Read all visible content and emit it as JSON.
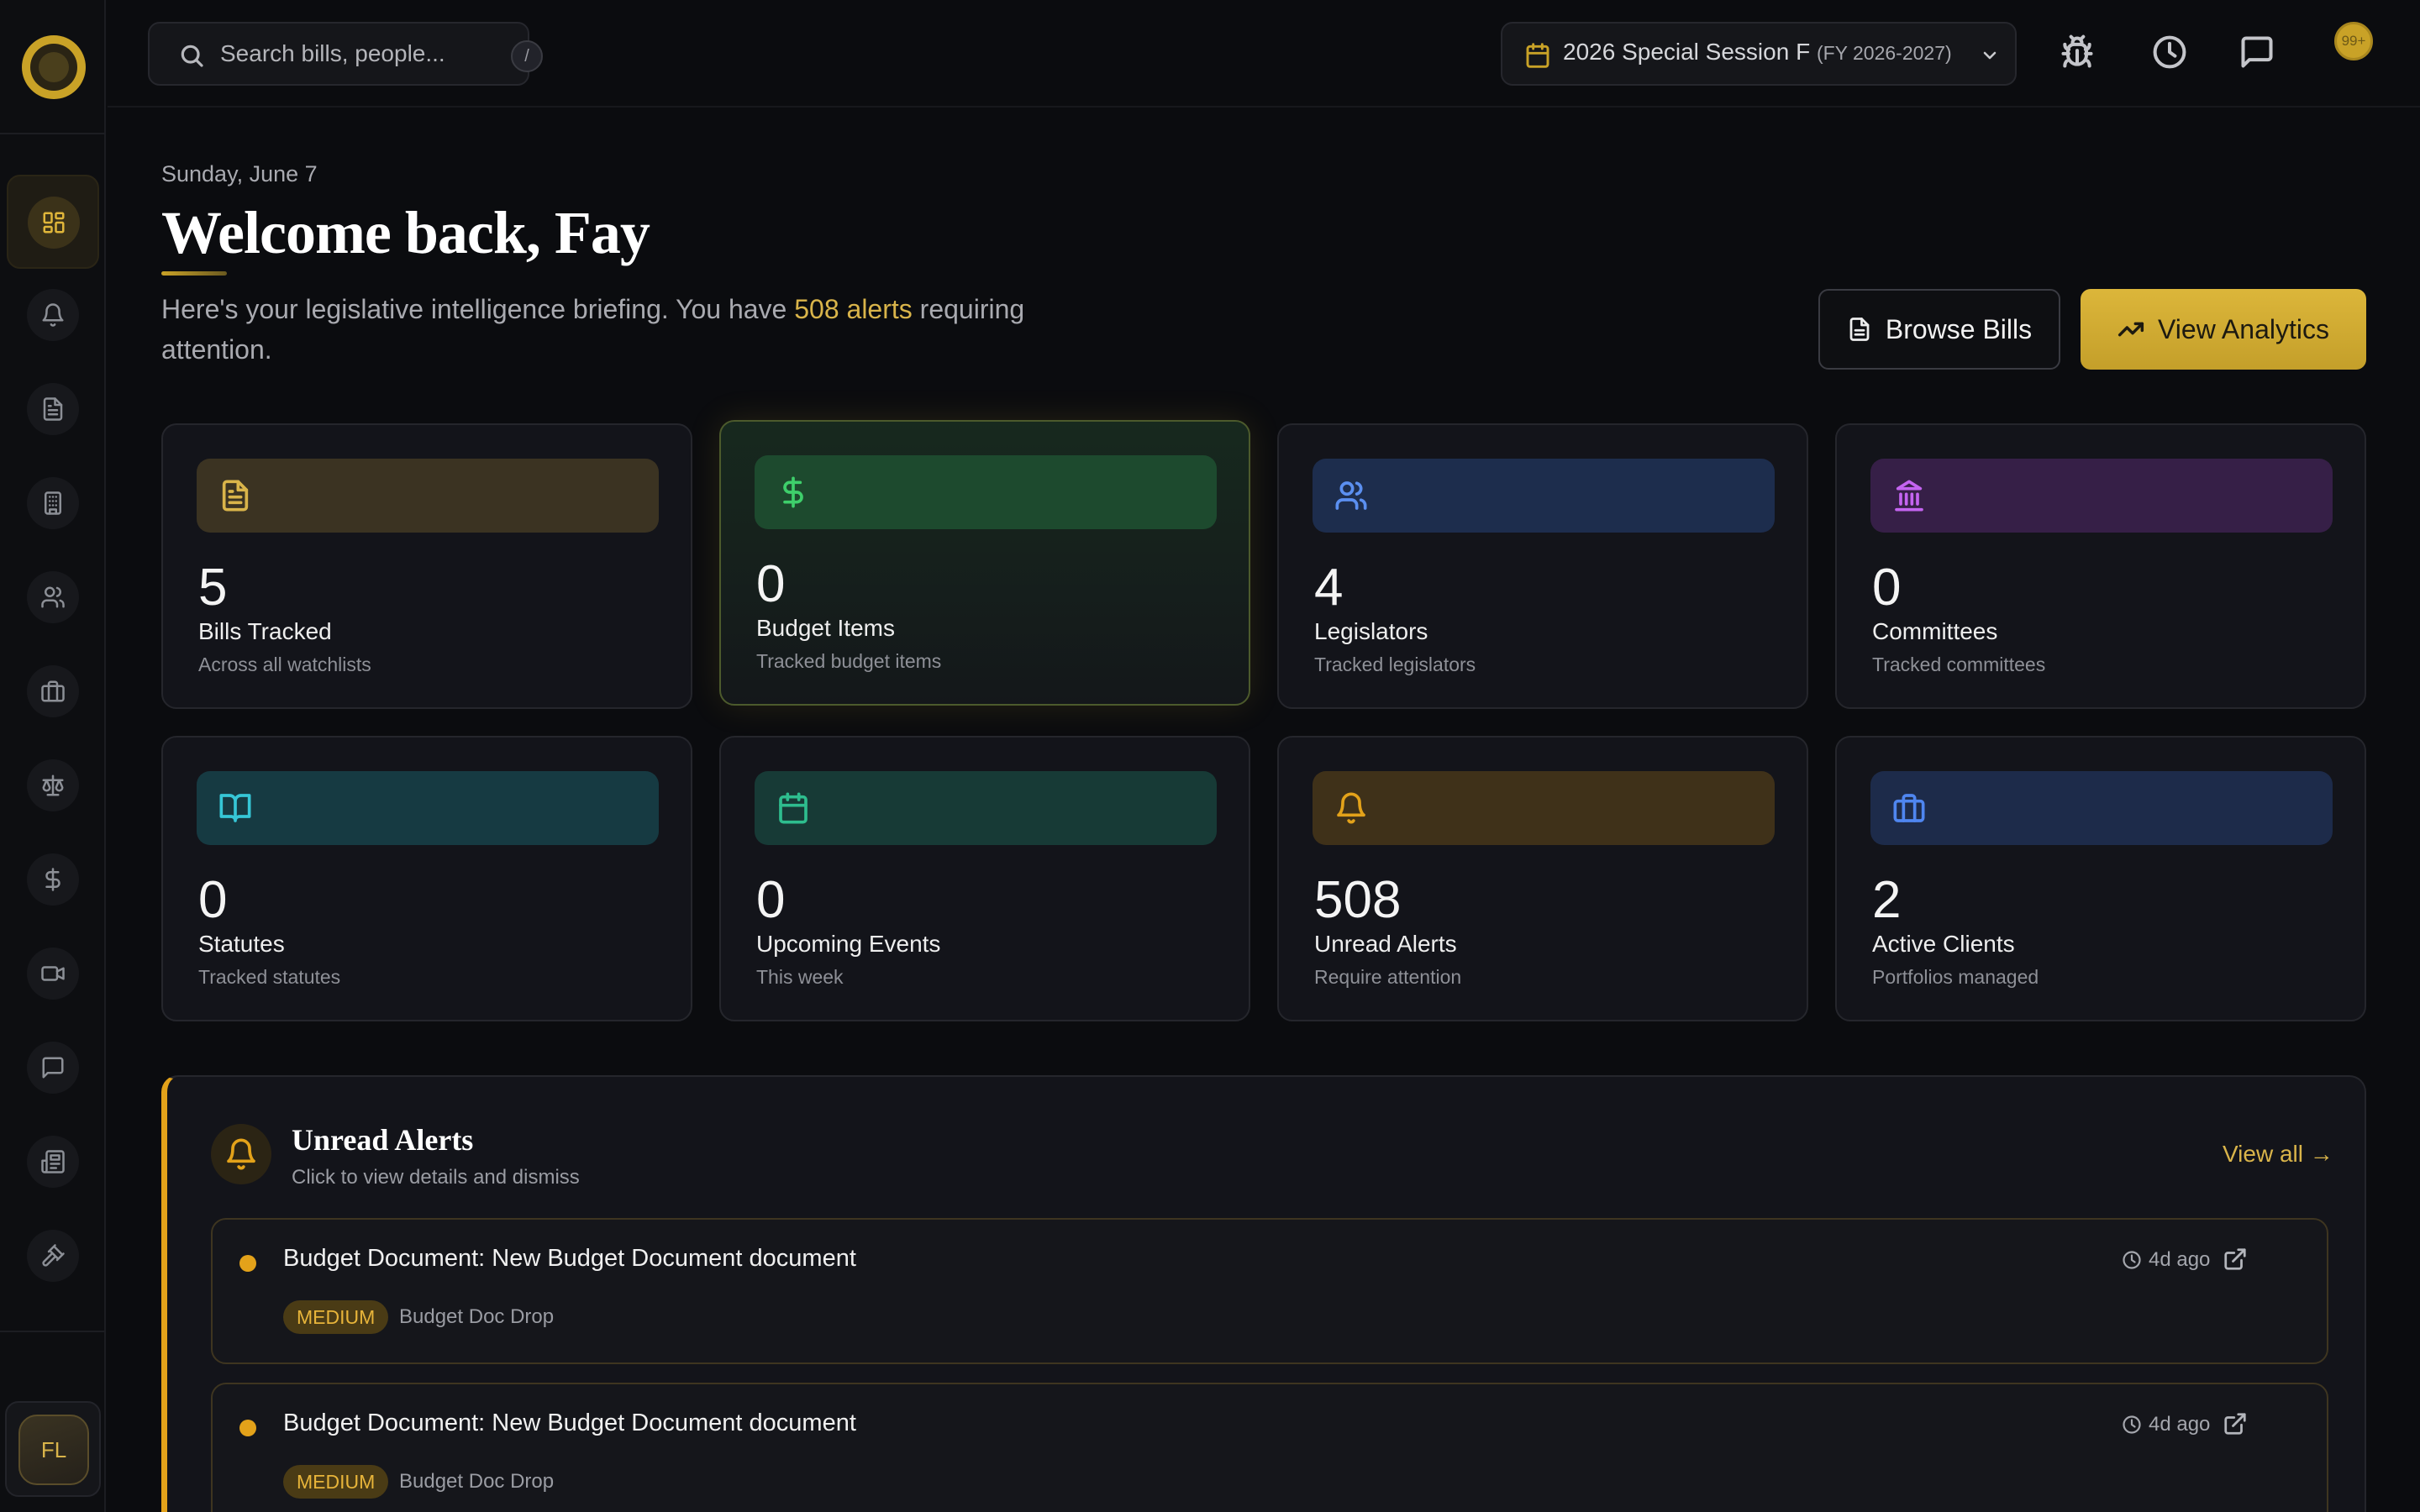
{
  "app": {
    "accent": "#c9a227",
    "background": "#0b0c0f"
  },
  "sidebar": {
    "items": [
      {
        "name": "dashboard",
        "icon": "dashboard-icon",
        "active": true
      },
      {
        "name": "alerts",
        "icon": "bell-icon"
      },
      {
        "name": "bills",
        "icon": "document-icon"
      },
      {
        "name": "buildings",
        "icon": "building-icon"
      },
      {
        "name": "people",
        "icon": "users-icon"
      },
      {
        "name": "clients",
        "icon": "briefcase-icon"
      },
      {
        "name": "statutes-law",
        "icon": "scale-icon"
      },
      {
        "name": "budget",
        "icon": "dollar-icon"
      },
      {
        "name": "video",
        "icon": "video-icon"
      },
      {
        "name": "messages",
        "icon": "chat-icon"
      },
      {
        "name": "news",
        "icon": "newspaper-icon"
      },
      {
        "name": "hearings",
        "icon": "gavel-icon"
      }
    ],
    "user_initials": "FL"
  },
  "topbar": {
    "search_placeholder": "Search bills, people...",
    "search_shortcut": "/",
    "session_label": "2026 Special Session F",
    "session_fy": "(FY 2026-2027)",
    "notification_badge": "99+",
    "icons": [
      "bug-icon",
      "history-icon",
      "chat-icon",
      "bell-icon"
    ]
  },
  "header": {
    "date": "Sunday, June 7",
    "welcome": "Welcome back, Fay",
    "intro_before": "Here's your legislative intelligence briefing. You have ",
    "intro_highlight": "508 alerts",
    "intro_after": " requiring attention.",
    "browse_bills_label": "Browse Bills",
    "view_analytics_label": "View Analytics"
  },
  "stats": [
    {
      "value": "5",
      "label": "Bills Tracked",
      "sub": "Across all watchlists",
      "icon": "document-icon",
      "color": "#d9b44a",
      "band": "#3b3322"
    },
    {
      "value": "0",
      "label": "Budget Items",
      "sub": "Tracked budget items",
      "icon": "dollar-icon",
      "color": "#3ecf6b",
      "band": "#1d4a2e"
    },
    {
      "value": "4",
      "label": "Legislators",
      "sub": "Tracked legislators",
      "icon": "users-icon",
      "color": "#5b8ff0",
      "band": "#1d2d4d"
    },
    {
      "value": "0",
      "label": "Committees",
      "sub": "Tracked committees",
      "icon": "landmark-icon",
      "color": "#c464f0",
      "band": "#361f47"
    },
    {
      "value": "0",
      "label": "Statutes",
      "sub": "Tracked statutes",
      "icon": "book-icon",
      "color": "#36c6d6",
      "band": "#163a42"
    },
    {
      "value": "0",
      "label": "Upcoming Events",
      "sub": "This week",
      "icon": "calendar-icon",
      "color": "#2ebd8e",
      "band": "#173a36"
    },
    {
      "value": "508",
      "label": "Unread Alerts",
      "sub": "Require attention",
      "icon": "bell-icon",
      "color": "#e3a21a",
      "band": "#3f3119"
    },
    {
      "value": "2",
      "label": "Active Clients",
      "sub": "Portfolios managed",
      "icon": "briefcase-icon",
      "color": "#4f86f0",
      "band": "#1d2b4a"
    }
  ],
  "alerts": {
    "title": "Unread Alerts",
    "subtitle": "Click to view details and dismiss",
    "view_all": "View all →",
    "items": [
      {
        "title": "Budget Document: New Budget Document document",
        "time": "4d ago",
        "severity": "MEDIUM",
        "source": "Budget Doc Drop"
      },
      {
        "title": "Budget Document: New Budget Document document",
        "time": "4d ago",
        "severity": "MEDIUM",
        "source": "Budget Doc Drop"
      }
    ]
  }
}
